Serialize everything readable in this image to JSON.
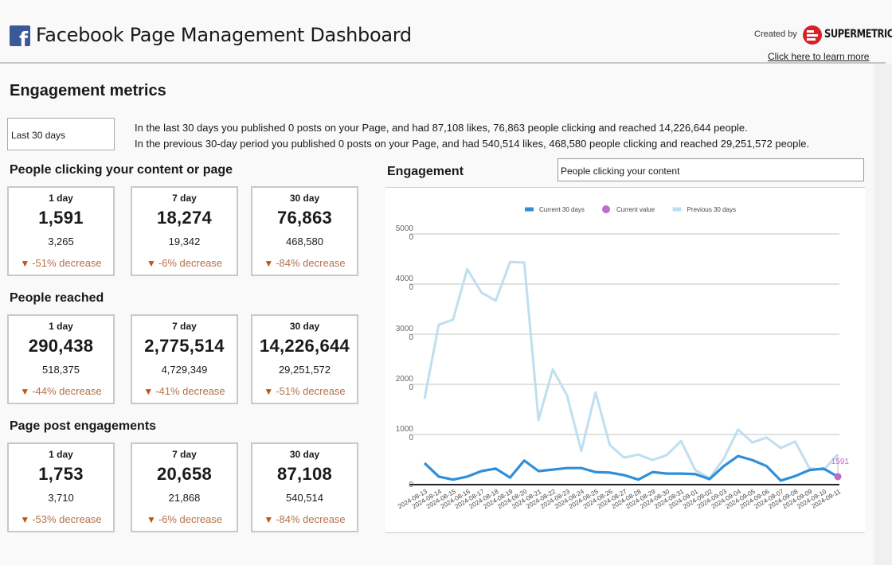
{
  "header": {
    "title": "Facebook Page Management Dashboard",
    "logo_icon": "facebook-f",
    "created_by": "Created by",
    "brand": "SUPERMETRICS",
    "learn_more": "Click here to learn more"
  },
  "section_title": "Engagement metrics",
  "date_range": {
    "selected": "Last 30 days"
  },
  "summary": {
    "line1": "In the last 30 days you published 0 posts on your Page, and had 87,108 likes, 76,863 people clicking and reached 14,226,644 people.",
    "line2": "In the previous 30-day period you published 0 posts on your Page, and had 540,514 likes, 468,580 people clicking and reached 29,251,572 people."
  },
  "groups": [
    {
      "title": "People clicking your content or page",
      "cards": [
        {
          "period": "1 day",
          "value": "1,591",
          "previous": "3,265",
          "change": "-51% decrease"
        },
        {
          "period": "7 day",
          "value": "18,274",
          "previous": "19,342",
          "change": "-6% decrease"
        },
        {
          "period": "30 day",
          "value": "76,863",
          "previous": "468,580",
          "change": "-84% decrease"
        }
      ]
    },
    {
      "title": "People reached",
      "cards": [
        {
          "period": "1 day",
          "value": "290,438",
          "previous": "518,375",
          "change": "-44% decrease"
        },
        {
          "period": "7 day",
          "value": "2,775,514",
          "previous": "4,729,349",
          "change": "-41% decrease"
        },
        {
          "period": "30 day",
          "value": "14,226,644",
          "previous": "29,251,572",
          "change": "-51% decrease"
        }
      ]
    },
    {
      "title": "Page post engagements",
      "cards": [
        {
          "period": "1 day",
          "value": "1,753",
          "previous": "3,710",
          "change": "-53% decrease"
        },
        {
          "period": "7 day",
          "value": "20,658",
          "previous": "21,868",
          "change": "-6% decrease"
        },
        {
          "period": "30 day",
          "value": "87,108",
          "previous": "540,514",
          "change": "-84% decrease"
        }
      ]
    }
  ],
  "change_icon": "triangle-down",
  "engagement": {
    "title": "Engagement",
    "metric_selected": "People clicking your content"
  },
  "chart_data": {
    "type": "line",
    "title": "",
    "xlabel": "",
    "ylabel": "",
    "ylim": [
      0,
      50000
    ],
    "yticks": [
      "0",
      "1000\n0",
      "2000\n0",
      "3000\n0",
      "4000\n0",
      "5000\n0"
    ],
    "ytick_values": [
      0,
      10000,
      20000,
      30000,
      40000,
      50000
    ],
    "grid": true,
    "legend": "top-center",
    "x": [
      "2024-08-13",
      "2024-08-14",
      "2024-08-15",
      "2024-08-16",
      "2024-08-17",
      "2024-08-18",
      "2024-08-19",
      "2024-08-20",
      "2024-08-21",
      "2024-08-22",
      "2024-08-23",
      "2024-08-24",
      "2024-08-25",
      "2024-08-26",
      "2024-08-27",
      "2024-08-28",
      "2024-08-29",
      "2024-08-30",
      "2024-08-31",
      "2024-09-01",
      "2024-09-02",
      "2024-09-03",
      "2024-09-04",
      "2024-09-05",
      "2024-09-06",
      "2024-09-07",
      "2024-09-08",
      "2024-09-09",
      "2024-09-10",
      "2024-09-11"
    ],
    "series": [
      {
        "name": "Current 30 days",
        "color": "#2f8fd8",
        "values": [
          4300,
          1600,
          1000,
          1600,
          2700,
          3200,
          1400,
          4800,
          2700,
          3000,
          3300,
          3300,
          2500,
          2400,
          1900,
          1000,
          2500,
          2200,
          2200,
          2100,
          1100,
          3700,
          5700,
          4900,
          3700,
          800,
          1700,
          2900,
          3200,
          1591
        ]
      },
      {
        "name": "Current value",
        "color": "#bb6fc8",
        "type": "point",
        "x": "2024-09-11",
        "value": 1591,
        "label": "1591"
      },
      {
        "name": "Previous 30 days",
        "color": "#bfdff0",
        "values": [
          17100,
          31900,
          32900,
          43000,
          38300,
          36700,
          44400,
          44300,
          12900,
          23000,
          17800,
          6700,
          18400,
          7900,
          5400,
          6000,
          4900,
          5900,
          8700,
          2900,
          1300,
          5200,
          11000,
          8400,
          9400,
          7300,
          8600,
          3300,
          2900,
          6000
        ]
      }
    ]
  }
}
